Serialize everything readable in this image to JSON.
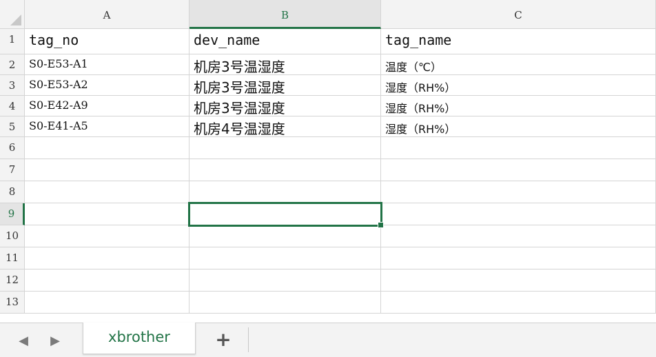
{
  "columns": [
    "A",
    "B",
    "C"
  ],
  "rows": [
    "1",
    "2",
    "3",
    "4",
    "5",
    "6",
    "7",
    "8",
    "9",
    "10",
    "11",
    "12",
    "13"
  ],
  "cells": {
    "header": [
      "tag_no",
      "dev_name",
      "tag_name"
    ],
    "data": [
      [
        "S0-E53-A1",
        "机房3号温湿度",
        "温度（℃）"
      ],
      [
        "S0-E53-A2",
        "机房3号温湿度",
        "湿度（RH%）"
      ],
      [
        "S0-E42-A9",
        "机房3号温湿度",
        "湿度（RH%）"
      ],
      [
        "S0-E41-A5",
        "机房4号温湿度",
        "湿度（RH%）"
      ]
    ]
  },
  "selected_cell": "B9",
  "sheet_tabs": [
    {
      "label": "xbrother",
      "active": true
    }
  ],
  "tab_nav": {
    "prev_icon": "chevron-left-icon",
    "next_icon": "chevron-right-icon",
    "add_icon": "plus-icon",
    "add_label": "+"
  },
  "colors": {
    "accent": "#217346",
    "header_bg": "#f3f3f3",
    "gridline": "#d4d4d4"
  }
}
